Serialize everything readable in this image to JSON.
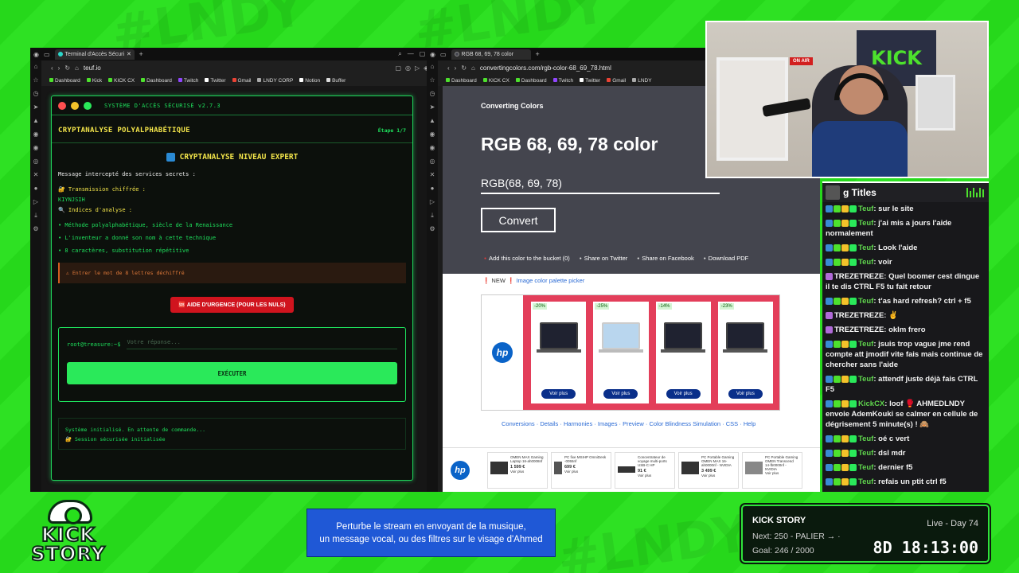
{
  "colors": {
    "stream_green": "#27e01c",
    "terminal_green": "#1ee05c",
    "kick_green": "#4de12d",
    "ad_red": "#e33e5a"
  },
  "left_browser": {
    "tab_title": "Terminal d'Accès Sécuri",
    "url": "teuf.io",
    "bookmarks": [
      "Dashboard",
      "Kick",
      "KICK CX",
      "Dashboard",
      "Twitch",
      "Twitter",
      "Gmail",
      "LNDY CORP",
      "Notion",
      "Buffer"
    ]
  },
  "terminal": {
    "window_title": "SYSTÈME D'ACCÈS SÉCURISÉ v2.7.3",
    "section_title": "CRYPTANALYSE POLYALPHABÉTIQUE",
    "step": "Étape 1/7",
    "main_title": "CRYPTANALYSE NIVEAU EXPERT",
    "intro": "Message intercepté des services secrets :",
    "cipher_label": "🔐 Transmission chiffrée :",
    "cipher_value": "KIYNJSIH",
    "hints_label": "🔍 Indices d'analyse :",
    "hints": [
      "• Méthode polyalphabétique, siècle de la Renaissance",
      "• L'inventeur a donné son nom à cette technique",
      "• 8 caractères, substitution répétitive"
    ],
    "warning": "⚠ Entrer le mot de 8 lettres déchiffré",
    "urgent_button": "🆘 AIDE D'URGENCE (POUR LES NULS)",
    "prompt": "root@treasure:~$",
    "input_placeholder": "Votre réponse...",
    "execute_button": "EXÉCUTER",
    "log_lines": [
      "Système initialisé. En attente de commande...",
      "🔐 Session sécurisée initialisée"
    ]
  },
  "mid_browser": {
    "tab_title": "RGB 68, 69, 78 color",
    "url": "convertingcolors.com/rgb-color-68_69_78.html",
    "bookmarks": [
      "Dashboard",
      "KICK CX",
      "Dashboard",
      "Twitch",
      "Twitter",
      "Gmail",
      "LNDY"
    ],
    "brand": "Converting Colors",
    "heading": "RGB 68, 69, 78 color",
    "input_value": "RGB(68, 69, 78)",
    "convert_button": "Convert",
    "actions": [
      "Add this color to the bucket (0)",
      "Share on Twitter",
      "Share on Facebook",
      "Download PDF"
    ],
    "new_label": "❗ NEW ❗",
    "new_link": "Image color palette picker",
    "ad_discounts": [
      "-20%",
      "-25%",
      "-14%",
      "-23%"
    ],
    "ad_button": "Voir plus",
    "page_links": "Conversions · Details · Harmonies · Images · Preview · Color Blindness Simulation · CSS · Help",
    "bottom_ad_items": [
      {
        "name": "OMEN MAX Gaming Laptop 16-ah0008nf",
        "price": "1 599 €"
      },
      {
        "name": "PC fixe MSIHP OmniDesk -0055nf",
        "price": "699 €"
      },
      {
        "name": "Concentrateur de voyage multi-ports USB-C HP",
        "price": "91 €"
      },
      {
        "name": "PC Portable Gaming OMEN MAX 16-ah0000nf - NVIDIA",
        "price": "3 499 €"
      },
      {
        "name": "PC Portable Gaming OMEN Transcend 14-fb0000nf - NVIDIA",
        "price": ""
      }
    ]
  },
  "webcam": {
    "banner": "KICK",
    "sign": "ON AIR"
  },
  "chat": {
    "title": "g Titles",
    "messages": [
      {
        "user": "Teuf",
        "text": "sur le site"
      },
      {
        "user": "Teuf",
        "text": "j'ai mis a jours l'aide normalement"
      },
      {
        "user": "Teuf",
        "text": "Look l'aide"
      },
      {
        "user": "Teuf",
        "text": "voir"
      },
      {
        "user": "TREZETREZE",
        "text": "Quel boomer cest dingue il te dis CTRL F5 tu fait retour"
      },
      {
        "user": "Teuf",
        "text": "t'as hard refresh? ctrl + f5"
      },
      {
        "user": "TREZETREZE",
        "text": "✌️"
      },
      {
        "user": "TREZETREZE",
        "text": "oklm frero"
      },
      {
        "user": "Teuf",
        "text": "jsuis trop vague jme rend compte att jmodif vite fais mais continue de chercher sans l'aide"
      },
      {
        "user": "Teuf",
        "text": "attendf juste déjà fais CTRL F5"
      },
      {
        "user": "KickCX",
        "text": "loof 🥊 AHMEDLNDY envoie AdemKouki se calmer en cellule de dégrisement 5 minute(s) ! 🙈"
      },
      {
        "user": "Teuf",
        "text": "oé c vert"
      },
      {
        "user": "Teuf",
        "text": "dsl mdr"
      },
      {
        "user": "Teuf",
        "text": "dernier f5"
      },
      {
        "user": "Teuf",
        "text": "refais un ptit ctrl f5"
      }
    ]
  },
  "logo": {
    "line1": "KICK",
    "line2": "STORY"
  },
  "banner": {
    "line1": "Perturbe le stream en envoyant de la musique,",
    "line2": "un message vocal, ou des filtres sur le visage d'Ahmed"
  },
  "story": {
    "title": "KICK STORY",
    "live": "Live - Day 74",
    "next": "Next: 250 - PALIER → ·",
    "goal": "Goal: 246 / 2000",
    "timer": "8D 18:13:00"
  }
}
